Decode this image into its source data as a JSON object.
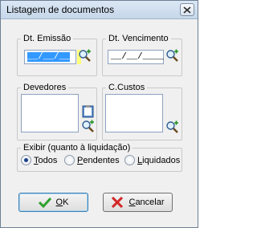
{
  "window": {
    "title": "Listagem de documentos"
  },
  "dates": {
    "emissao": {
      "label": "Dt. Emissão",
      "value": "__/__/__"
    },
    "vencimento": {
      "label": "Dt. Vencimento",
      "value": "__/__/____"
    }
  },
  "lists": {
    "devedores": {
      "label": "Devedores"
    },
    "custos": {
      "label": "C.Custos"
    }
  },
  "exibir": {
    "label": "Exibir (quanto à liquidação)",
    "options": [
      {
        "first": "T",
        "rest": "odos",
        "checked": true
      },
      {
        "first": "P",
        "rest": "endentes",
        "checked": false
      },
      {
        "first": "L",
        "rest": "iquidados",
        "checked": false
      }
    ]
  },
  "buttons": {
    "ok_first": "O",
    "ok_rest": "K",
    "cancel_first": "C",
    "cancel_rest": "ancelar"
  },
  "icons": {
    "search": "magnifier-plus-icon",
    "close": "close-x-icon",
    "check": "green-check-icon",
    "cancel": "red-x-icon",
    "clipboard": "clipboard-icon"
  }
}
